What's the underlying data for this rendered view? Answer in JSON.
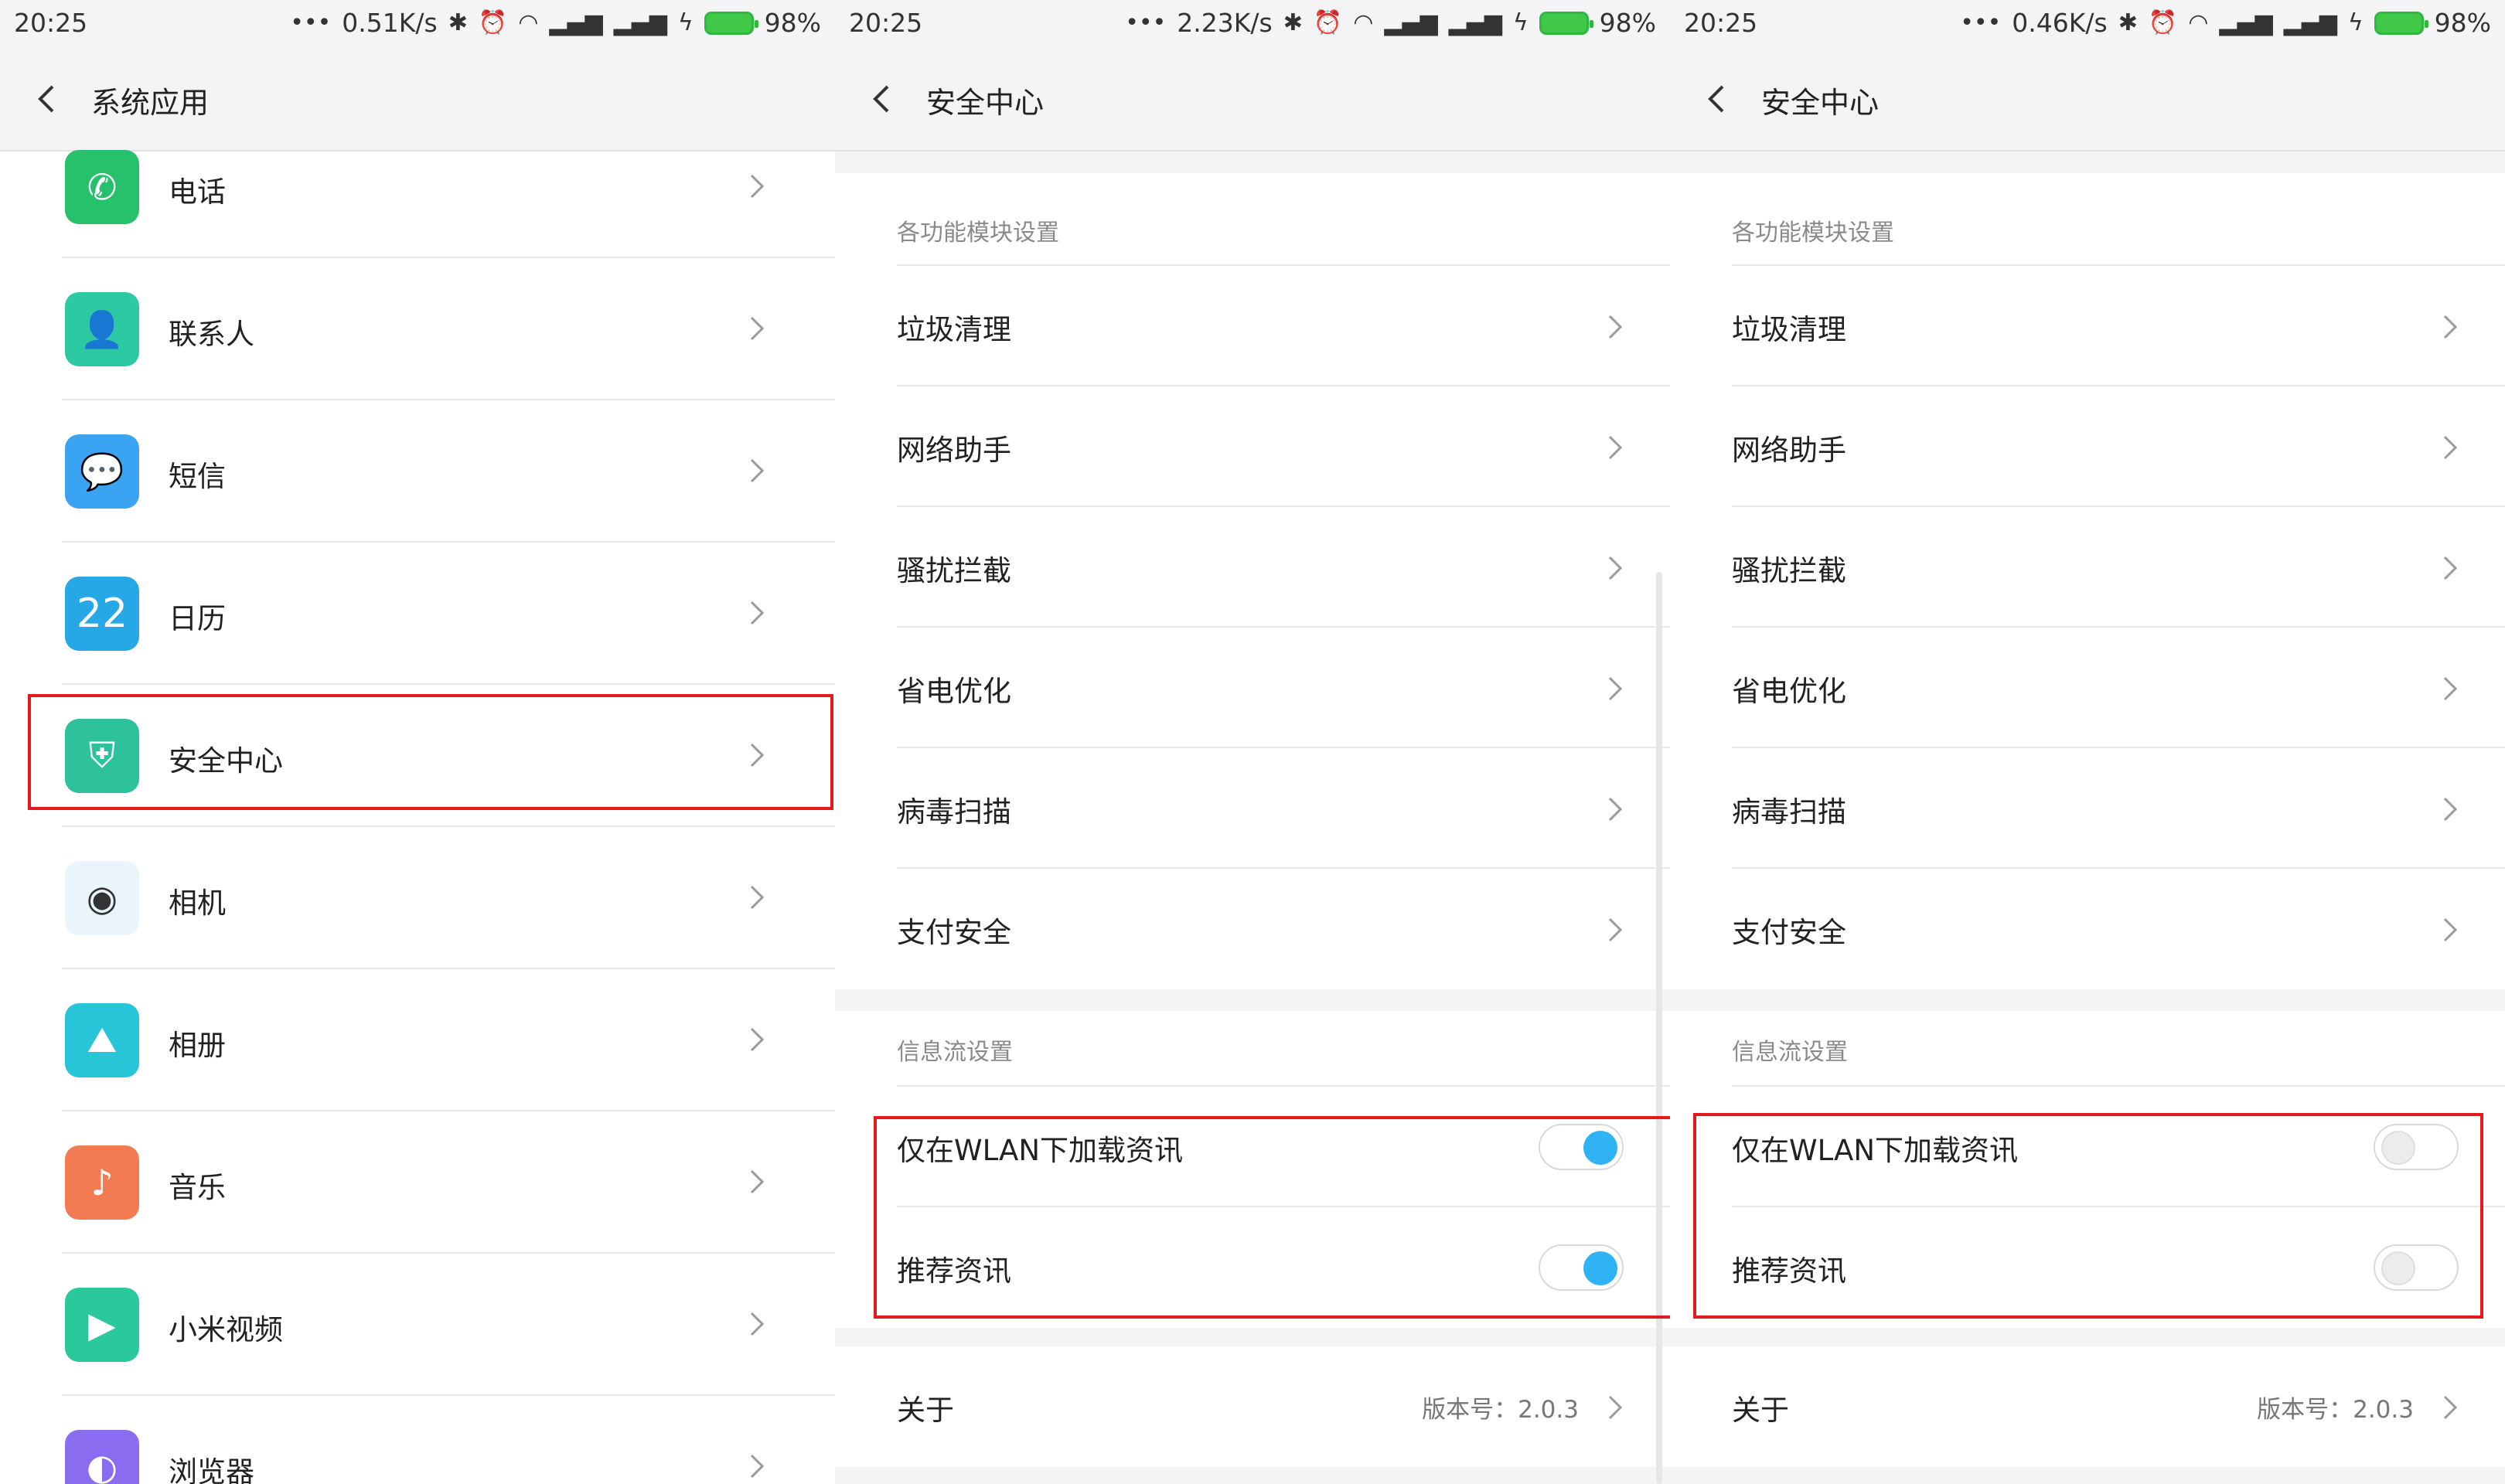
{
  "panels": [
    {
      "status": {
        "time": "20:25",
        "speed": "0.51K/s",
        "battery": "98%"
      },
      "title": "系统应用",
      "apps": [
        {
          "label": "电话",
          "icon": "phone-icon",
          "color": "#27c06b"
        },
        {
          "label": "联系人",
          "icon": "contacts-icon",
          "color": "#2dc9a2"
        },
        {
          "label": "短信",
          "icon": "messages-icon",
          "color": "#3aa4f3"
        },
        {
          "label": "日历",
          "icon": "calendar-icon",
          "color": "#27a8e6",
          "badge": "22"
        },
        {
          "label": "安全中心",
          "icon": "shield-icon",
          "color": "#2dc29c"
        },
        {
          "label": "相机",
          "icon": "camera-icon",
          "color": "#e9f4fb"
        },
        {
          "label": "相册",
          "icon": "gallery-icon",
          "color": "#28c5d8"
        },
        {
          "label": "音乐",
          "icon": "music-icon",
          "color": "#f27b52"
        },
        {
          "label": "小米视频",
          "icon": "video-icon",
          "color": "#2bc89c"
        },
        {
          "label": "浏览器",
          "icon": "browser-icon",
          "color": "#8a6cf0"
        }
      ]
    },
    {
      "status": {
        "time": "20:25",
        "speed": "2.23K/s",
        "battery": "98%"
      },
      "title": "安全中心",
      "section1": "各功能模块设置",
      "modules": [
        "垃圾清理",
        "网络助手",
        "骚扰拦截",
        "省电优化",
        "病毒扫描",
        "支付安全"
      ],
      "section2": "信息流设置",
      "wlan_label": "仅在WLAN下加载资讯",
      "recommend_label": "推荐资讯",
      "wlan_on": true,
      "recommend_on": true,
      "about_label": "关于",
      "version": "版本号：2.0.3"
    },
    {
      "status": {
        "time": "20:25",
        "speed": "0.46K/s",
        "battery": "98%"
      },
      "title": "安全中心",
      "section1": "各功能模块设置",
      "modules": [
        "垃圾清理",
        "网络助手",
        "骚扰拦截",
        "省电优化",
        "病毒扫描",
        "支付安全"
      ],
      "section2": "信息流设置",
      "wlan_label": "仅在WLAN下加载资讯",
      "recommend_label": "推荐资讯",
      "wlan_on": false,
      "recommend_on": false,
      "about_label": "关于",
      "version": "版本号：2.0.3"
    }
  ],
  "colors": {
    "highlight": "#e3191d",
    "toggle_on": "#2fb3f5",
    "battery": "#40c848"
  }
}
